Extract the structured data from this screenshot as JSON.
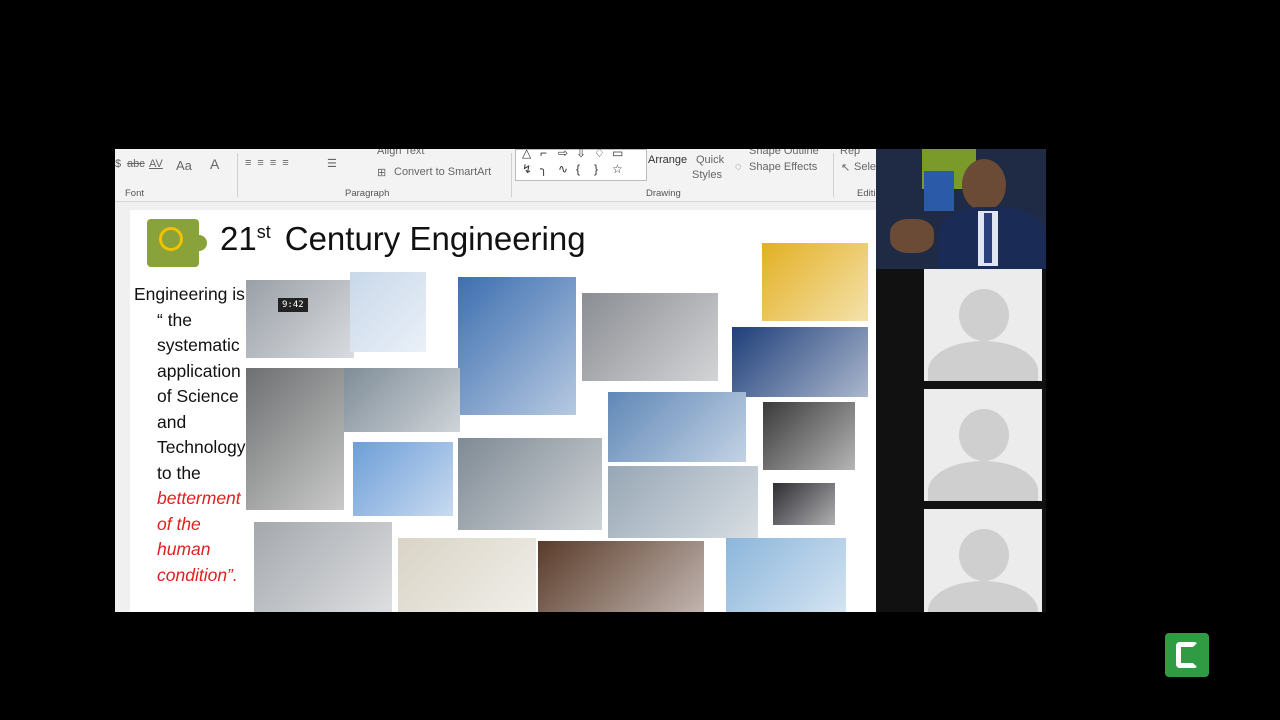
{
  "ribbon": {
    "font": {
      "label": "Font",
      "abc": "abc",
      "av": "AV",
      "aa": "Aa",
      "font_color": "A"
    },
    "paragraph": {
      "label": "Paragraph",
      "align_text": "Align Text",
      "convert_smartart": "Convert to SmartArt"
    },
    "drawing": {
      "label": "Drawing",
      "arrange": "Arrange",
      "quick_styles_1": "Quick",
      "quick_styles_2": "Styles",
      "shape_outline": "Shape Outline",
      "shape_effects": "Shape Effects",
      "shapes_row1": [
        "△",
        "⌐",
        "⇨",
        "⇩",
        "♢",
        "▭"
      ],
      "shapes_row2": [
        "↯",
        "╮",
        "∿",
        "{",
        "}",
        "☆"
      ]
    },
    "editing": {
      "label": "Editi",
      "replace": "Rep",
      "select": "Sele"
    }
  },
  "slide": {
    "title_main": "21",
    "title_sup": "st",
    "title_rest": "Century Engineering",
    "definition_lines": [
      "Engineering is",
      "“ the",
      "systematic",
      "application",
      "of Science",
      "and",
      "Technology",
      "to the"
    ],
    "definition_emphasis": [
      "betterment",
      "of the",
      "human",
      "condition”."
    ],
    "clock_time": "9:42",
    "photos": [
      {
        "name": "photo-clock-radio",
        "color": "#9aa0a8"
      },
      {
        "name": "photo-toothbrush",
        "color": "#c8d8ea"
      },
      {
        "name": "photo-shower-cabin",
        "color": "#3d6fb0"
      },
      {
        "name": "photo-kitchen",
        "color": "#8a8d92"
      },
      {
        "name": "photo-gas-station",
        "color": "#e3b023"
      },
      {
        "name": "photo-car",
        "color": "#1e3f7a"
      },
      {
        "name": "photo-space-shuttle",
        "color": "#6e6f70"
      },
      {
        "name": "photo-dam",
        "color": "#7f8d98"
      },
      {
        "name": "photo-power-lines",
        "color": "#6d9ed8"
      },
      {
        "name": "photo-train",
        "color": "#7f8a94"
      },
      {
        "name": "photo-city-skyline",
        "color": "#5f88b7"
      },
      {
        "name": "photo-gps-device",
        "color": "#3a3a3a"
      },
      {
        "name": "photo-bridge",
        "color": "#97a7b5"
      },
      {
        "name": "photo-laptop",
        "color": "#2d2d33"
      },
      {
        "name": "photo-airplane",
        "color": "#a4a8ad"
      },
      {
        "name": "photo-mri-scanner",
        "color": "#d9d4c6"
      },
      {
        "name": "photo-cruise-ship",
        "color": "#5a3b2a"
      },
      {
        "name": "photo-ferris-wheel",
        "color": "#8bb6db"
      }
    ]
  },
  "participants": {
    "speaker": "speaker-video",
    "others": [
      "participant-1",
      "participant-2",
      "participant-3"
    ]
  },
  "app_logo_letter": "C"
}
